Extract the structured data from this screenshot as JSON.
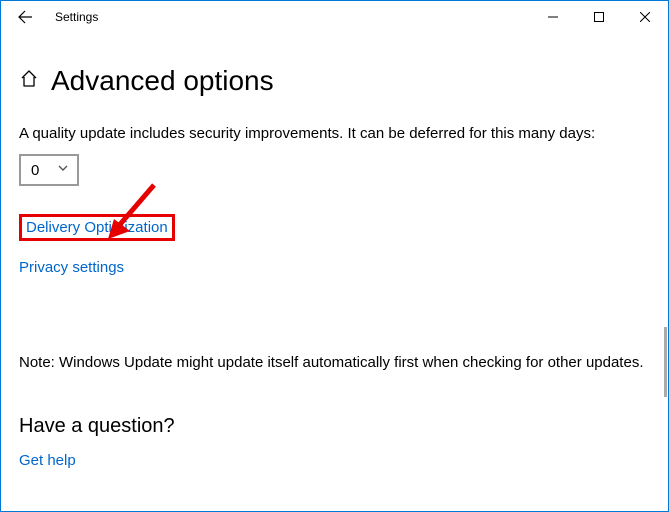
{
  "window": {
    "title": "Settings"
  },
  "page": {
    "heading": "Advanced options",
    "qualityDesc": "A quality update includes security improvements. It can be deferred for this many days:",
    "deferDays": "0",
    "linkDeliveryOpt": "Delivery Optimization",
    "linkPrivacy": "Privacy settings",
    "note": "Note: Windows Update might update itself automatically first when checking for other updates.",
    "questionHeading": "Have a question?",
    "getHelp": "Get help"
  }
}
